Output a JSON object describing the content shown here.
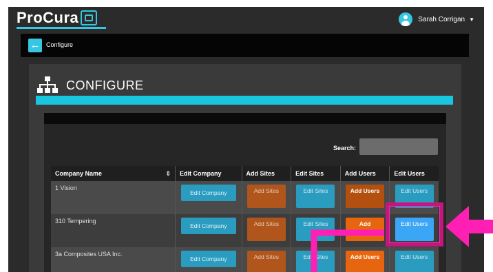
{
  "app": {
    "logo_text": "ProCura",
    "user_name": "Sarah Corrigan"
  },
  "breadcrumb": {
    "label": "Configure"
  },
  "panel": {
    "title": "CONFIGURE"
  },
  "search": {
    "label": "Search:",
    "value": ""
  },
  "table": {
    "headers": [
      "Company Name",
      "Edit Company",
      "Add Sites",
      "Edit Sites",
      "Add Users",
      "Edit Users"
    ],
    "rows": [
      {
        "company": "1 Vision",
        "edit_company": "Edit Company",
        "add_sites": "Add Sites",
        "edit_sites": "Edit Sites",
        "add_users": "Add Users",
        "edit_users": "Edit Users"
      },
      {
        "company": "310 Tempering",
        "edit_company": "Edit Company",
        "add_sites": "Add Sites",
        "edit_sites": "Edit Sites",
        "add_users": "Add",
        "edit_users": "Edit Users"
      },
      {
        "company": "3a Composites USA Inc.",
        "edit_company": "Edit Company",
        "add_sites": "Add Sites",
        "edit_sites": "Edit Sites",
        "add_users": "Add Users",
        "edit_users": "Edit Users"
      }
    ]
  },
  "colors": {
    "accent": "#19c6e0",
    "annotation": "#ff1fb4",
    "orange": "#e8650f"
  }
}
